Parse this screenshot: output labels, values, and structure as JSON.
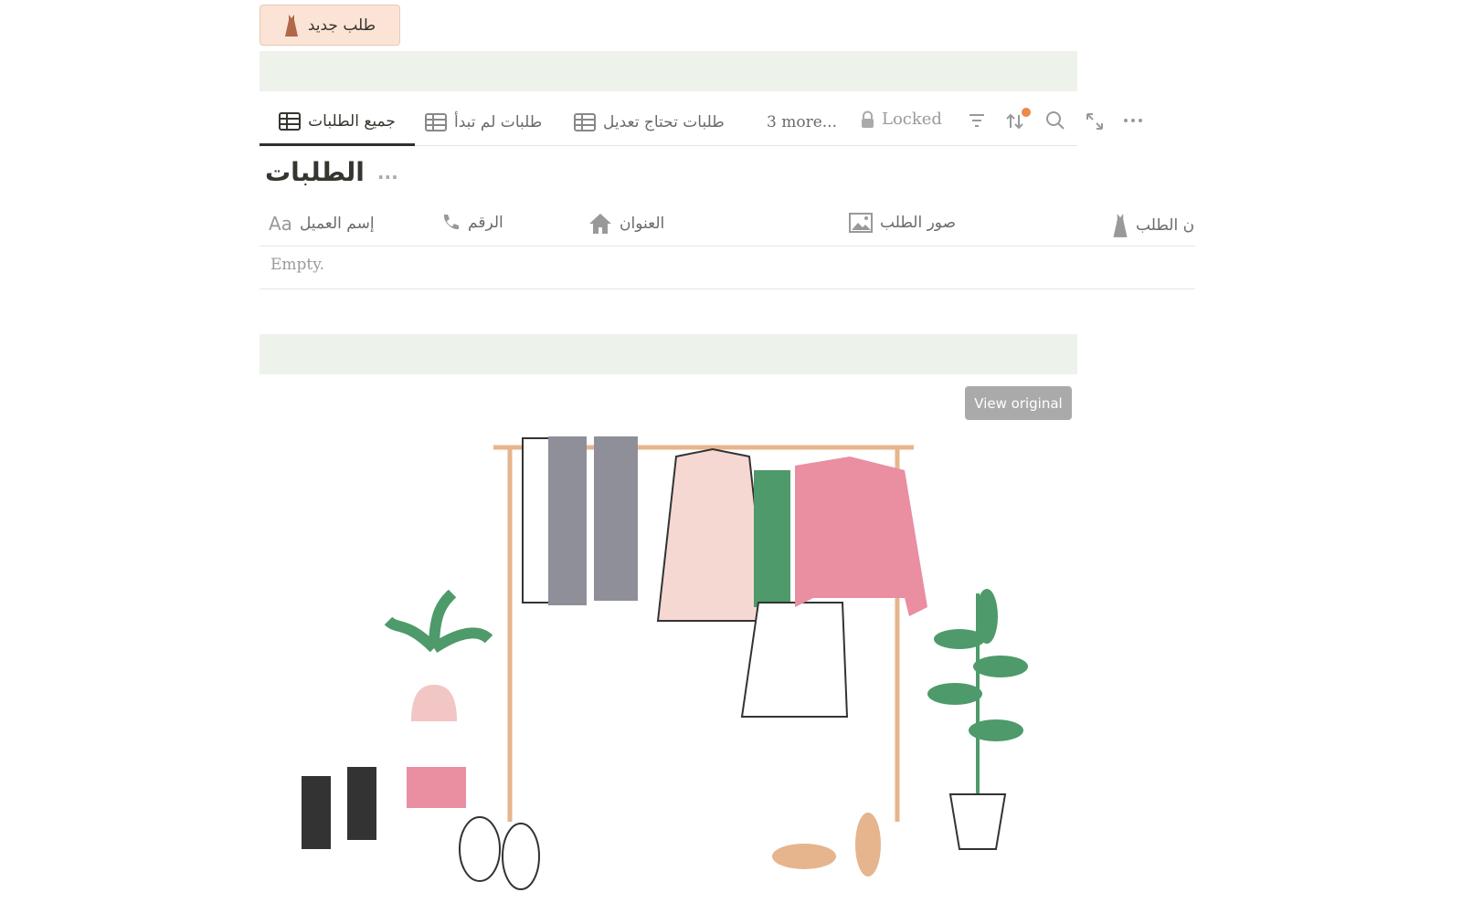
{
  "new_button": {
    "label": "طلب جديد",
    "icon": "dress-icon",
    "color": "#fbe4d5"
  },
  "tabs": [
    {
      "label": "جميع الطلبات",
      "icon": "table-icon",
      "active": true
    },
    {
      "label": "طلبات لم تبدأ",
      "icon": "table-icon"
    },
    {
      "label": "طلبات تحتاج تعديل",
      "icon": "table-icon"
    }
  ],
  "more_tabs": "3 more...",
  "locked": "Locked",
  "toolbar_icons": [
    "filter-icon",
    "sort-icon",
    "search-icon",
    "expand-icon",
    "more-icon"
  ],
  "database": {
    "title": "الطلبات",
    "menu": "..."
  },
  "columns": [
    {
      "label": "إسم العميل",
      "icon": "text-icon",
      "icon_text": "Aa"
    },
    {
      "label": "الرقم",
      "icon": "phone-icon"
    },
    {
      "label": "العنوان",
      "icon": "home-icon"
    },
    {
      "label": "صور الطلب",
      "icon": "image-icon"
    },
    {
      "label": "ن الطلب",
      "icon": "dress-icon"
    }
  ],
  "empty_text": "Empty.",
  "view_original": "View original",
  "colors": {
    "band": "#edf2ea",
    "accent_dot": "#eb8a4a"
  }
}
